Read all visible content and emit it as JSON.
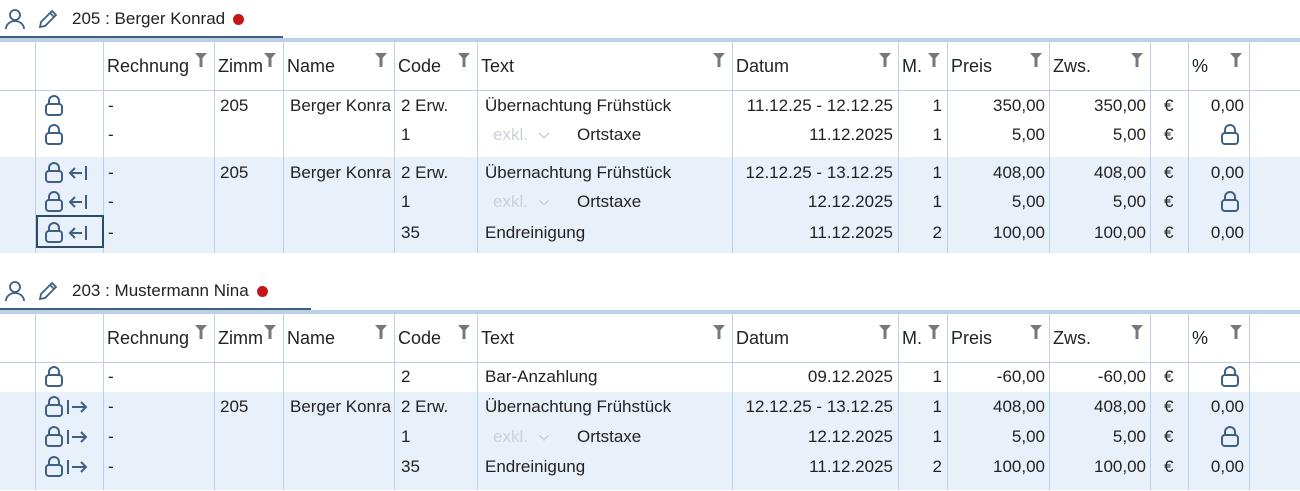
{
  "columns": {
    "rechnung": "Rechnung",
    "zimmer": "Zimmer",
    "name": "Name",
    "code": "Code",
    "text": "Text",
    "datum": "Datum",
    "m": "M.",
    "preis": "Preis",
    "zws": "Zws.",
    "pct": "%"
  },
  "currency": "€",
  "colors": {
    "accent": "#3f5f84",
    "band": "#e8f0f9",
    "grid": "#bcd0e6",
    "status_dot": "#c41818"
  },
  "sections": [
    {
      "title": "205 :  Berger Konrad",
      "rows": [
        {
          "icon": "lock-icon",
          "rechnung": "-",
          "zimmer": "205",
          "name": "Berger Konrad",
          "code": "2 Erw.",
          "select": "",
          "text": "Übernachtung Frühstück",
          "datum": "11.12.25 - 12.12.25",
          "m": "1",
          "preis": "350,00",
          "zws": "350,00",
          "cur": "€",
          "pct": "0,00"
        },
        {
          "icon": "lock-icon",
          "rechnung": "-",
          "zimmer": "",
          "name": "",
          "code": "1",
          "select": "exkl.",
          "text": "Ortstaxe",
          "datum": "11.12.2025",
          "m": "1",
          "preis": "5,00",
          "zws": "5,00",
          "cur": "€",
          "pct": ""
        },
        {
          "icon": "lock-transfer-in-icon",
          "rechnung": "-",
          "zimmer": "205",
          "name": "Berger Konrad",
          "code": "2 Erw.",
          "select": "",
          "text": "Übernachtung Frühstück",
          "datum": "12.12.25 - 13.12.25",
          "m": "1",
          "preis": "408,00",
          "zws": "408,00",
          "cur": "€",
          "pct": "0,00"
        },
        {
          "icon": "lock-transfer-in-icon",
          "rechnung": "-",
          "zimmer": "",
          "name": "",
          "code": "1",
          "select": "exkl.",
          "text": "Ortstaxe",
          "datum": "12.12.2025",
          "m": "1",
          "preis": "5,00",
          "zws": "5,00",
          "cur": "€",
          "pct": ""
        },
        {
          "icon": "lock-transfer-in-icon",
          "rechnung": "-",
          "zimmer": "",
          "name": "",
          "code": "35",
          "select": "",
          "text": "Endreinigung",
          "datum": "11.12.2025",
          "m": "2",
          "preis": "100,00",
          "zws": "100,00",
          "cur": "€",
          "pct": "0,00"
        }
      ]
    },
    {
      "title": "203 :  Mustermann Nina",
      "rows": [
        {
          "icon": "lock-icon",
          "rechnung": "-",
          "zimmer": "",
          "name": "",
          "code": "2",
          "select": "",
          "text": "Bar-Anzahlung",
          "datum": "09.12.2025",
          "m": "1",
          "preis": "-60,00",
          "zws": "-60,00",
          "cur": "€",
          "pct": ""
        },
        {
          "icon": "lock-transfer-out-icon",
          "rechnung": "-",
          "zimmer": "205",
          "name": "Berger Konrad",
          "code": "2 Erw.",
          "select": "",
          "text": "Übernachtung Frühstück",
          "datum": "12.12.25 - 13.12.25",
          "m": "1",
          "preis": "408,00",
          "zws": "408,00",
          "cur": "€",
          "pct": "0,00"
        },
        {
          "icon": "lock-transfer-out-icon",
          "rechnung": "-",
          "zimmer": "",
          "name": "",
          "code": "1",
          "select": "exkl.",
          "text": "Ortstaxe",
          "datum": "12.12.2025",
          "m": "1",
          "preis": "5,00",
          "zws": "5,00",
          "cur": "€",
          "pct": ""
        },
        {
          "icon": "lock-transfer-out-icon",
          "rechnung": "-",
          "zimmer": "",
          "name": "",
          "code": "35",
          "select": "",
          "text": "Endreinigung",
          "datum": "11.12.2025",
          "m": "2",
          "preis": "100,00",
          "zws": "100,00",
          "cur": "€",
          "pct": "0,00"
        }
      ]
    }
  ]
}
